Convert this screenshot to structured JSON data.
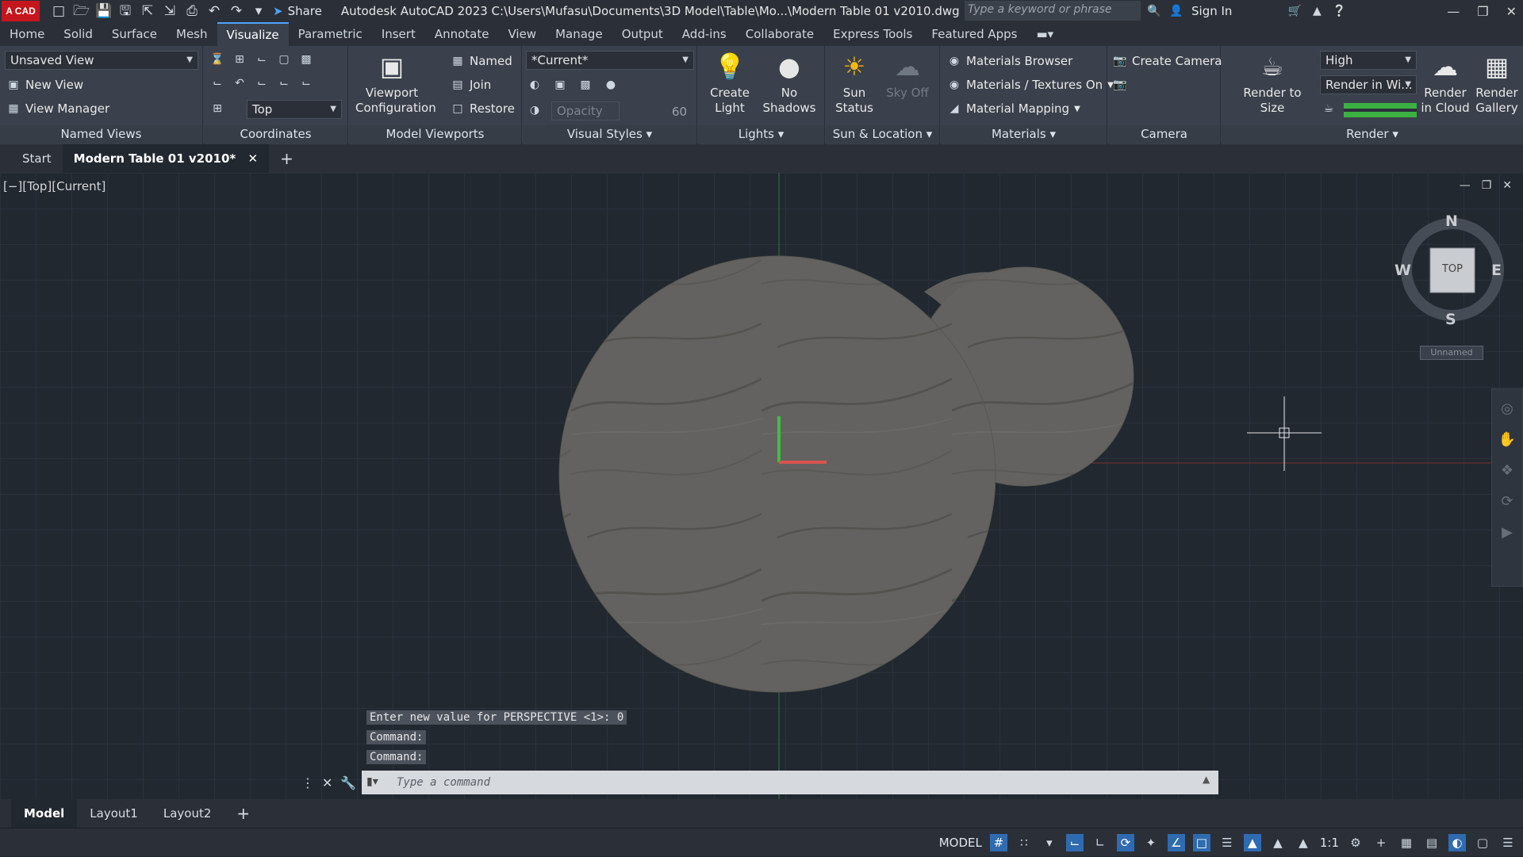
{
  "titlebar": {
    "logo": "A CAD",
    "share_label": "Share",
    "title": "Autodesk AutoCAD 2023    C:\\Users\\Mufasu\\Documents\\3D Model\\Table\\Mo...\\Modern Table 01 v2010.dwg",
    "search_placeholder": "Type a keyword or phrase",
    "sign_in": "Sign In"
  },
  "tabs": [
    "Home",
    "Solid",
    "Surface",
    "Mesh",
    "Visualize",
    "Parametric",
    "Insert",
    "Annotate",
    "View",
    "Manage",
    "Output",
    "Add-ins",
    "Collaborate",
    "Express Tools",
    "Featured Apps"
  ],
  "active_tab": "Visualize",
  "ribbon": {
    "named_views": {
      "title": "Named Views",
      "current_view": "Unsaved View",
      "new_view": "New View",
      "view_manager": "View Manager"
    },
    "coordinates": {
      "title": "Coordinates",
      "ucs": "Top"
    },
    "model_viewports": {
      "title": "Model Viewports",
      "viewport_config": "Viewport Configuration",
      "named": "Named",
      "join": "Join",
      "restore": "Restore"
    },
    "visual_styles": {
      "title": "Visual Styles",
      "style": "*Current*",
      "opacity_label": "Opacity",
      "opacity_value": "60"
    },
    "lights": {
      "title": "Lights",
      "create_light": "Create Light",
      "no_shadows": "No Shadows"
    },
    "sun": {
      "title": "Sun & Location",
      "sun_status": "Sun Status",
      "sky_off": "Sky Off"
    },
    "materials": {
      "title": "Materials",
      "browser": "Materials Browser",
      "textures": "Materials / Textures On",
      "mapping": "Material Mapping"
    },
    "camera": {
      "title": "Camera",
      "create_camera": "Create Camera"
    },
    "render": {
      "title": "Render",
      "render_to_size": "Render to Size",
      "quality": "High",
      "render_in": "Render in Wi...",
      "render_cloud": "Render in Cloud",
      "render_gallery": "Render Gallery"
    }
  },
  "doc_tabs": {
    "start": "Start",
    "active": "Modern Table 01 v2010*"
  },
  "viewport": {
    "label": "[−][Top][Current]",
    "viewcube": {
      "n": "N",
      "s": "S",
      "e": "E",
      "w": "W",
      "face": "TOP",
      "ucs_name": "Unnamed"
    },
    "colors": {
      "table_top": "#636260",
      "x_axis": "#d9534f",
      "y_axis": "#3fbf3f"
    }
  },
  "command": {
    "history": [
      "Enter new value for PERSPECTIVE <1>: 0",
      "Command:",
      "Command:"
    ],
    "placeholder": "Type a command"
  },
  "layouts": [
    "Model",
    "Layout1",
    "Layout2"
  ],
  "status": {
    "model_label": "MODEL",
    "scale": "1:1"
  }
}
